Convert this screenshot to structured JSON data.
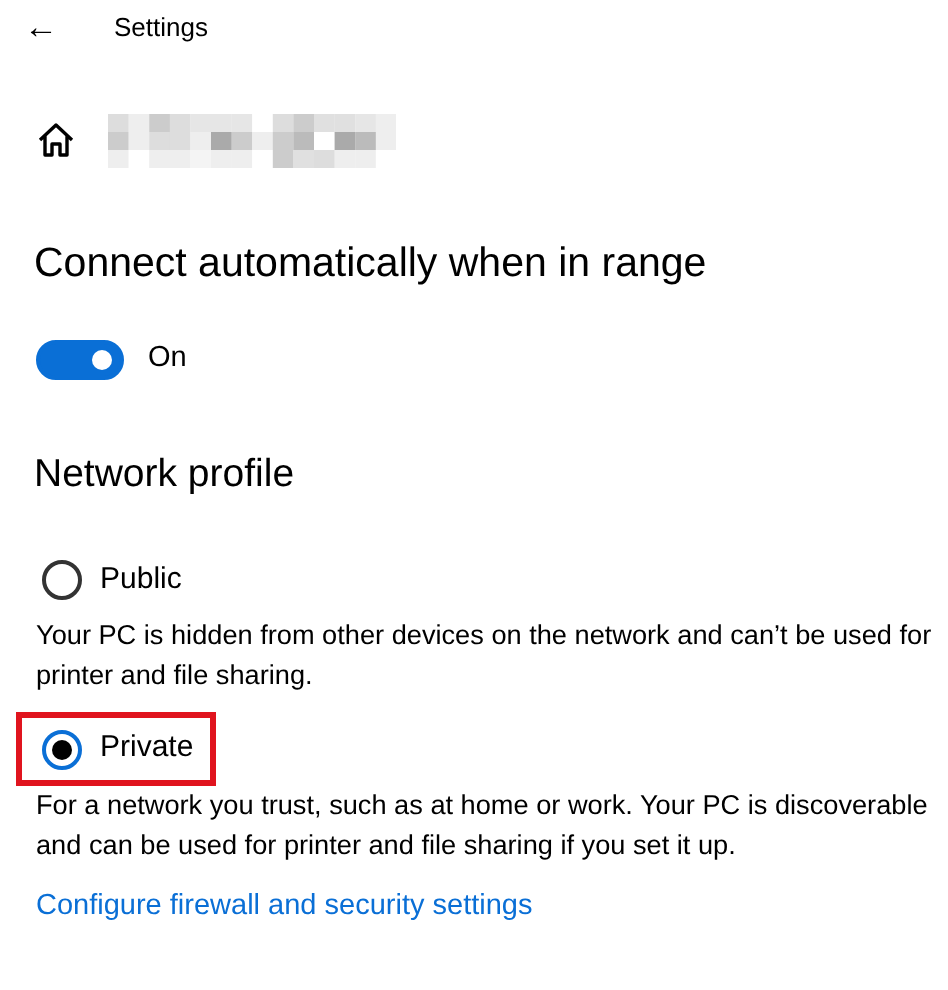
{
  "header": {
    "back_glyph": "←",
    "title": "Settings"
  },
  "connect": {
    "heading": "Connect automatically when in range",
    "on": true,
    "label": "On"
  },
  "profile": {
    "heading": "Network profile",
    "options": [
      {
        "label": "Public",
        "selected": false,
        "description": "Your PC is hidden from other devices on the network and can’t be used for printer and file sharing."
      },
      {
        "label": "Private",
        "selected": true,
        "description": "For a network you trust, such as at home or work. Your PC is discoverable and can be used for printer and file sharing if you set it up."
      }
    ]
  },
  "link": "Configure firewall and security settings"
}
